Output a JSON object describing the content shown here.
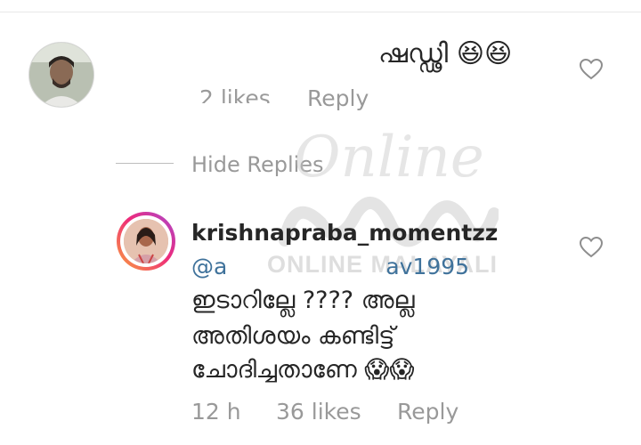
{
  "comment1": {
    "text": "ഷഡ്ഢി 😆😆",
    "likes": "2 likes",
    "reply": "Reply"
  },
  "thread": {
    "hide_replies": "Hide Replies"
  },
  "comment2": {
    "username": "krishnapraba_momentzz",
    "mention_start": "@a",
    "mention_end": "av1995",
    "lines": [
      "ഇടാറില്ലേ ???? അല്ല",
      "അതിശയം കണ്ടിട്ട്",
      "ചോദിച്ചതാണേ 😱😱"
    ],
    "time": "12 h",
    "likes": "36 likes",
    "reply": "Reply"
  },
  "watermark": {
    "script": "Online",
    "text": "ONLINE MALAYALI"
  },
  "icons": {
    "like": "heart-outline-icon"
  },
  "colors": {
    "meta": "#999999",
    "mention": "#3f729b",
    "text": "#262626"
  }
}
